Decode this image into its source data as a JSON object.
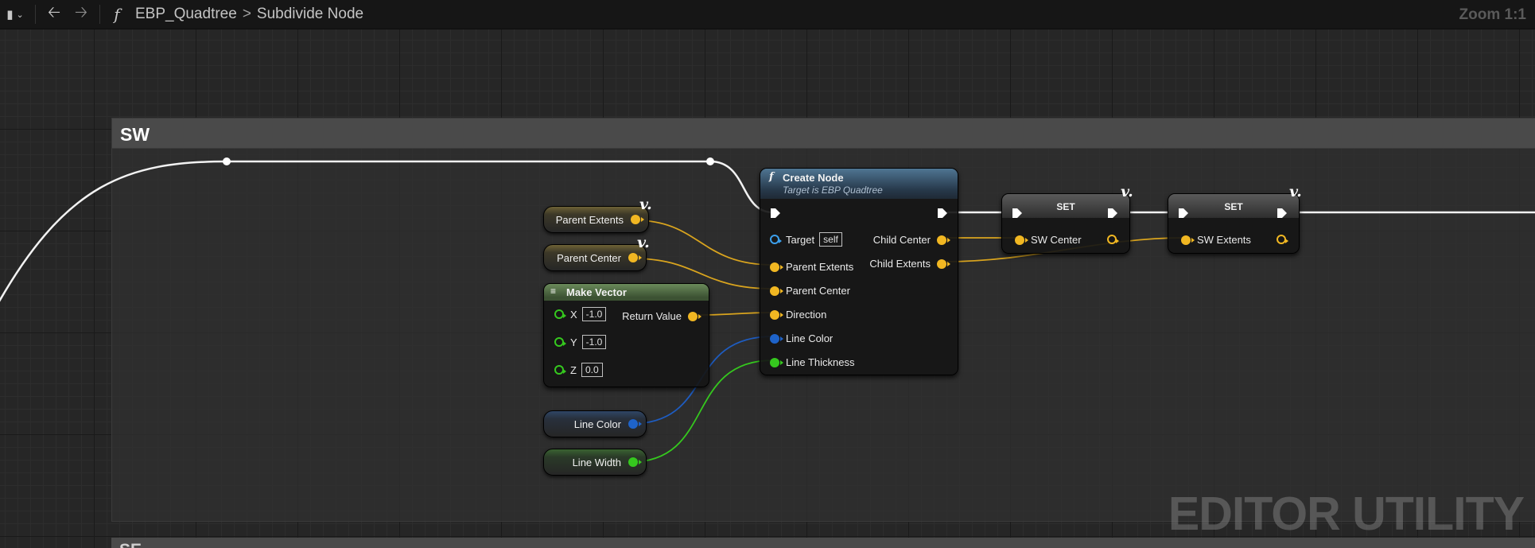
{
  "toolbar": {
    "breadcrumb_root": "EBP_Quadtree",
    "breadcrumb_child": "Subdivide Node",
    "zoom": "Zoom 1:1"
  },
  "comments": {
    "sw_title": "SW",
    "se_title": "SE"
  },
  "watermark": "EDITOR UTILITY",
  "variables": {
    "parent_extents": "Parent Extents",
    "parent_center": "Parent Center",
    "line_color": "Line Color",
    "line_width": "Line Width",
    "glyph": "v."
  },
  "make_vector": {
    "title": "Make Vector",
    "x_label": "X",
    "x_value": "-1.0",
    "y_label": "Y",
    "y_value": "-1.0",
    "z_label": "Z",
    "z_value": "0.0",
    "return_value": "Return Value"
  },
  "create_node": {
    "title": "Create Node",
    "subtitle": "Target is EBP Quadtree",
    "target_label": "Target",
    "target_value": "self",
    "inputs": [
      "Parent Extents",
      "Parent Center",
      "Direction",
      "Line Color",
      "Line Thickness"
    ],
    "outputs": [
      "Child Center",
      "Child Extents"
    ]
  },
  "set_nodes": [
    {
      "title": "SET",
      "pin_label": "SW Center"
    },
    {
      "title": "SET",
      "pin_label": "SW Extents"
    }
  ],
  "colors": {
    "vector": "#f1b722",
    "linear_color": "#1e63c9",
    "float": "#35c81e",
    "object": "#3ca0ec",
    "exec": "#ffffff",
    "function_header": "#4f7592",
    "struct_header": "#6a8a5a"
  }
}
